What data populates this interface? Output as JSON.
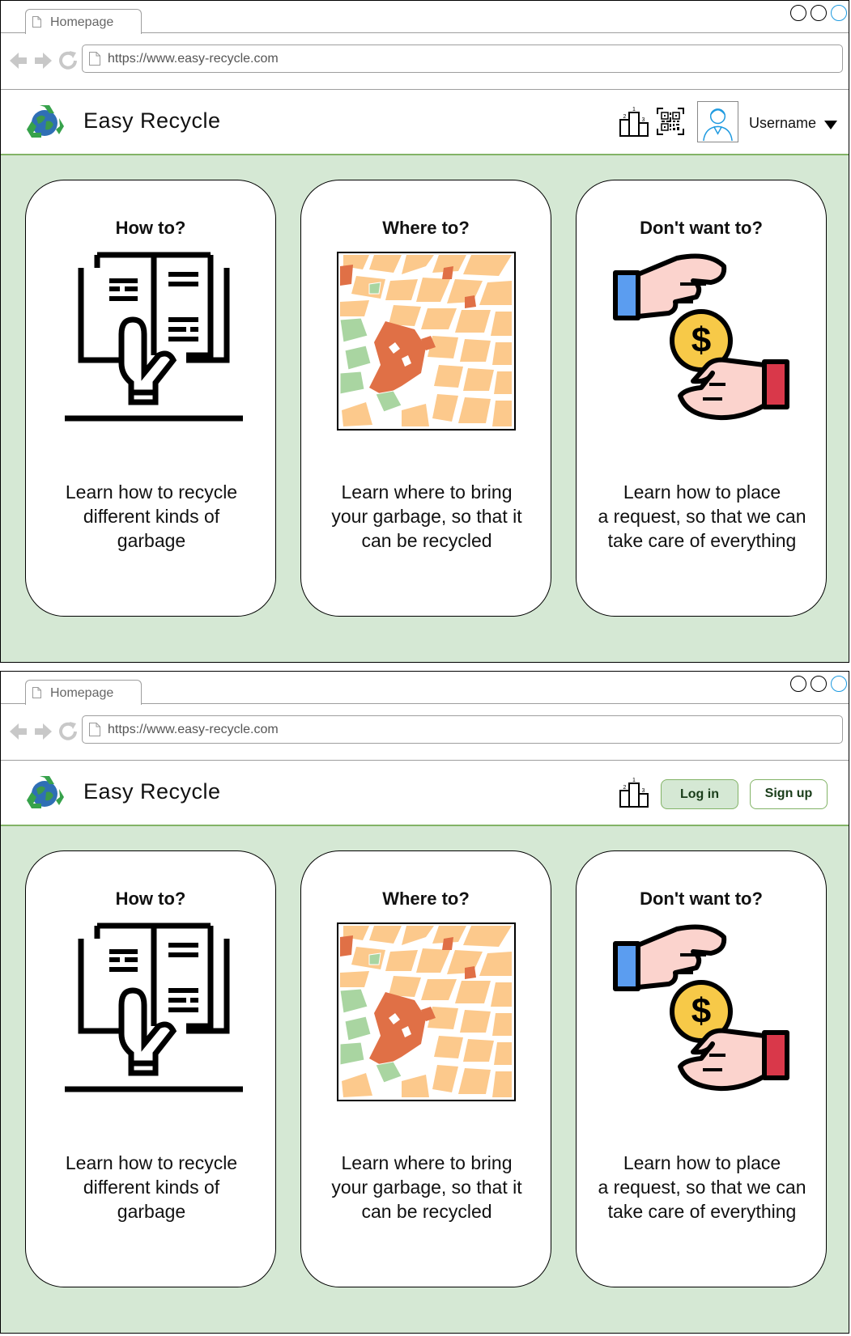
{
  "screens": [
    {
      "browser": {
        "tab_label": "Homepage",
        "url": "https://www.easy-recycle.com"
      },
      "header": {
        "brand": "Easy Recycle",
        "username": "Username"
      },
      "cards": [
        {
          "title": "How to?",
          "text_lines": [
            "Learn how to recycle",
            "different kinds of",
            "garbage"
          ]
        },
        {
          "title": "Where to?",
          "text_lines": [
            "Learn where to bring",
            "your garbage, so that it",
            "can be recycled"
          ]
        },
        {
          "title": "Don't want to?",
          "text_lines": [
            "Learn how to place",
            "a request, so that we can",
            "take care of everything"
          ]
        }
      ]
    },
    {
      "browser": {
        "tab_label": "Homepage",
        "url": "https://www.easy-recycle.com"
      },
      "header": {
        "brand": "Easy Recycle",
        "login_label": "Log in",
        "signup_label": "Sign up"
      },
      "cards": [
        {
          "title": "How to?",
          "text_lines": [
            "Learn how to recycle",
            "different kinds of",
            "garbage"
          ]
        },
        {
          "title": "Where to?",
          "text_lines": [
            "Learn where to bring",
            "your garbage, so that it",
            "can be recycled"
          ]
        },
        {
          "title": "Don't want to?",
          "text_lines": [
            "Learn how to place",
            "a request, so that we can",
            "take care of everything"
          ]
        }
      ]
    }
  ],
  "podium_numbers": [
    "1",
    "2",
    "3"
  ],
  "dollar_sign": "$",
  "colors": {
    "content_bg": "#d5e8d4",
    "accent_border": "#82b366",
    "map_blocks": "#fcc98c",
    "map_highlight": "#e07046",
    "map_park": "#a9d5a1",
    "coin": "#f7c948",
    "sleeve_blue": "#5b9df0",
    "sleeve_red": "#d9384a",
    "hand_skin": "#fbd3cd"
  },
  "icons": [
    "file-icon",
    "back-arrow-icon",
    "forward-arrow-icon",
    "reload-icon",
    "recycle-globe-logo",
    "leaderboard-podium-icon",
    "qr-code-icon",
    "user-avatar-icon",
    "dropdown-caret-icon",
    "book-hand-icon",
    "city-map-image",
    "money-exchange-icon"
  ]
}
